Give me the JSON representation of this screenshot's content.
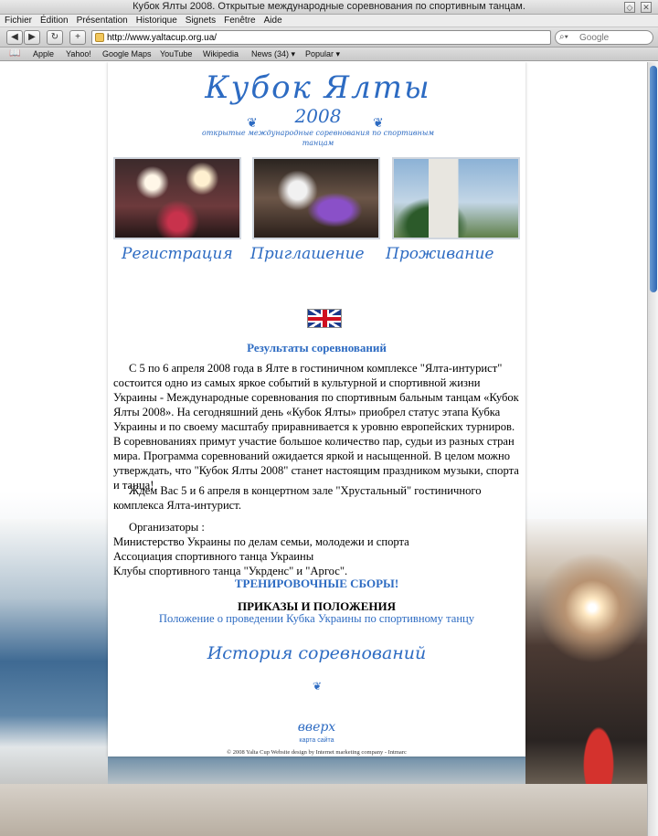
{
  "window": {
    "title": "Кубок Ялты 2008. Открытые международные соревнования по спортивным танцам.",
    "restore_glyph": "◇",
    "close_glyph": "✕"
  },
  "menu": [
    "Fichier",
    "Édition",
    "Présentation",
    "Historique",
    "Signets",
    "Fenêtre",
    "Aide"
  ],
  "toolbar": {
    "back_glyph": "◀",
    "forward_glyph": "▶",
    "reload_glyph": "↻",
    "add_glyph": "+",
    "url": "http://www.yaltacup.org.ua/",
    "search_placeholder": "Google",
    "search_glyph": "⌕▾"
  },
  "bookmarks": {
    "book_glyph": "📖",
    "items": [
      "Apple",
      "Yahoo!",
      "Google Maps",
      "YouTube",
      "Wikipedia",
      "News (34) ▾",
      "Popular ▾"
    ]
  },
  "logo": {
    "title": "Кубок Ялты",
    "year": "2008",
    "subtitle": "открытые международные соревнования по спортивным танцам",
    "flourish_left": "❦",
    "flourish_right": "❦"
  },
  "nav": {
    "registration": "Регистрация",
    "invitation": "Приглашение",
    "accommodation": "Проживание"
  },
  "main": {
    "results_link": "Результаты соревнований",
    "intro": "С 5 по 6 апреля 2008 года в Ялте в гостиничном комплексе \"Ялта-интурист\" состоится одно из самых яркое событий в культурной и спортивной жизни Украины -  Международные соревнования по спортивным бальным танцам «Кубок Ялты 2008». На сегодняшний день «Кубок Ялты» приобрел статус этапа Кубка Украины и по своему масштабу приравнивается к уровню европейских турниров. В соревнованиях примут участие большое количество пар, судьи из разных стран мира. Программа соревнований ожидается яркой и насыщенной. В целом можно утверждать, что \"Кубок Ялты 2008\" станет настоящим праздником музыки, спорта и танца!",
    "wait": "Ждем Вас 5 и 6 апреля в концертном зале \"Хрустальный\" гостиничного комплекса Ялта-интурист.",
    "organizers_label": "Организаторы :",
    "organizers": [
      "Министерство Украины по делам семьи, молодежи и спорта",
      "Ассоциация спортивного танца Украины",
      "Клубы спортивного танца \"Укрденс\" и \"Аргос\"."
    ],
    "trainings_link": "ТРЕНИРОВОЧНЫЕ СБОРЫ!",
    "orders_heading": "ПРИКАЗЫ И ПОЛОЖЕНИЯ",
    "regulation_link": "Положение о проведении Кубка Украины по спортивному танцу",
    "history_link": "История соревнований"
  },
  "footer": {
    "flourish": "❦",
    "up_link": "вверх",
    "sitemap_link": "карта сайта",
    "copyright": "© 2008 Yalta Cup Website design by Internet marketing company - Intmarc"
  },
  "colors": {
    "accent": "#2d6bc2",
    "scrollbar_thumb": "#2f67b3"
  }
}
